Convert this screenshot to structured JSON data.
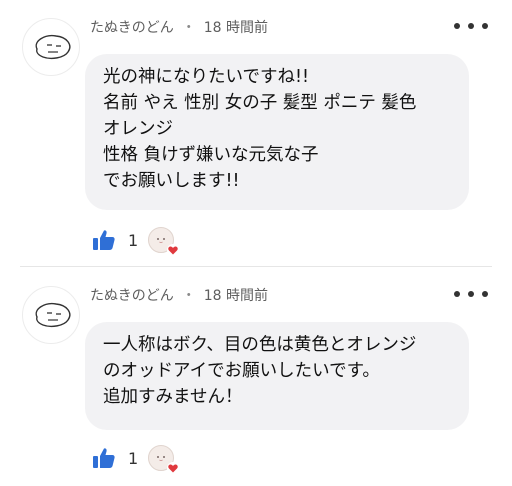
{
  "comments": [
    {
      "author": "たぬきのどん",
      "separator": "・",
      "time": "18 時間前",
      "lines": [
        "光の神になりたいですね!!",
        "名前 やえ 性別 女の子 髪型 ポニテ 髪色",
        "オレンジ",
        "性格 負けず嫌いな元気な子",
        "でお願いします!!"
      ],
      "like_count": "1"
    },
    {
      "author": "たぬきのどん",
      "separator": "・",
      "time": "18 時間前",
      "lines": [
        "一人称はボク、目の色は黄色とオレンジ",
        "のオッドアイでお願いしたいです。",
        "追加すみません！"
      ],
      "like_count": "1"
    }
  ],
  "colors": {
    "bubble": "#f2f2f4",
    "like_blue": "#2f6fd6",
    "heart_red": "#e0393e"
  },
  "icons": {
    "avatar": "doodle-face-avatar",
    "more": "more-dots-icon",
    "like": "thumbs-up-icon",
    "reaction": "heart-icon"
  }
}
